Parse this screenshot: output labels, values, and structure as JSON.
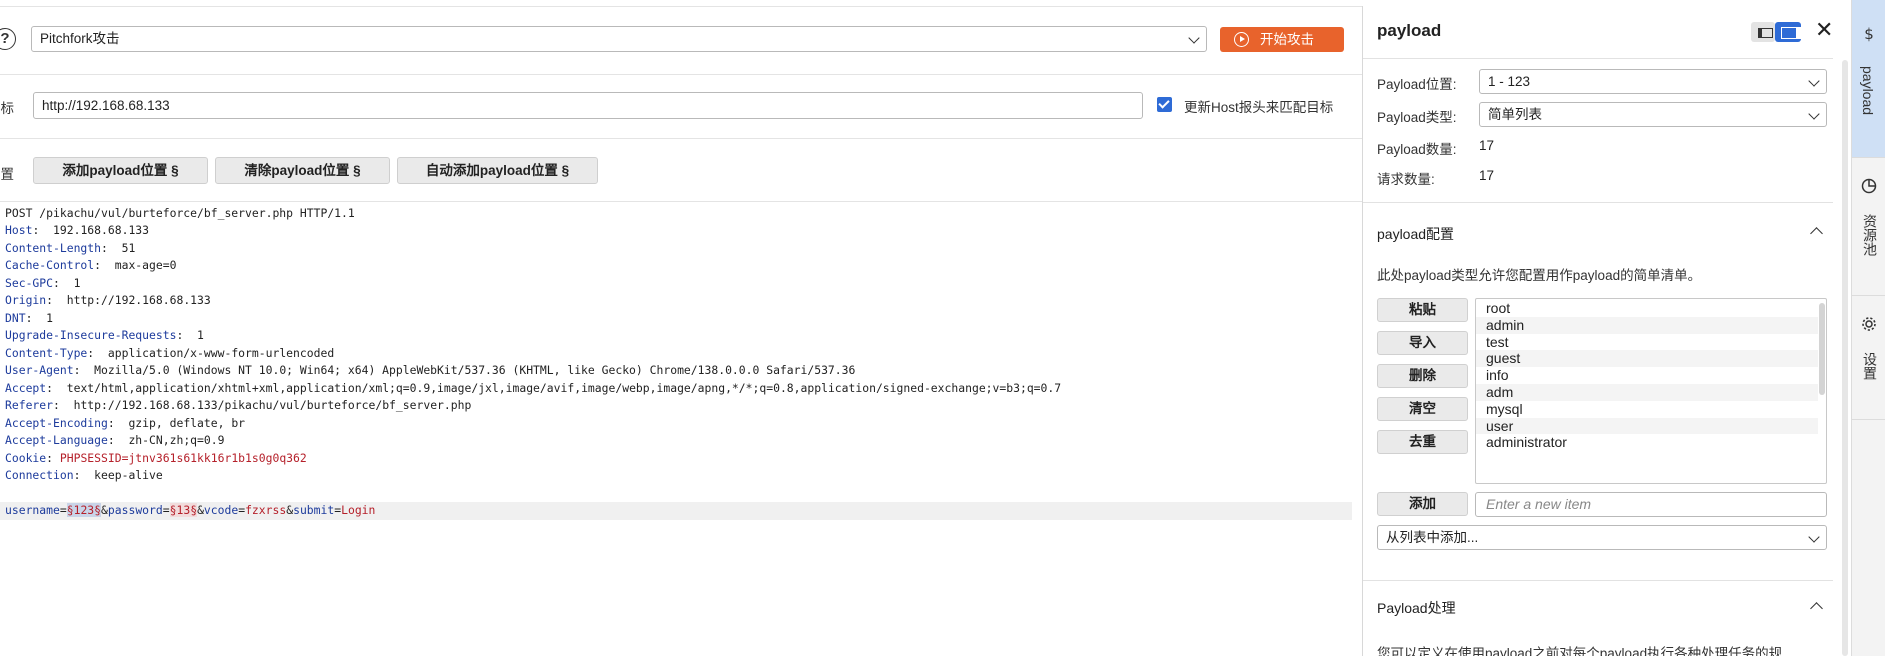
{
  "toolbar": {
    "help_icon": "?",
    "attack_type": "Pitchfork攻击",
    "start_attack": "开始攻击"
  },
  "target": {
    "label": "目标",
    "url": "http://192.168.68.133",
    "update_host_label": "更新Host报头来匹配目标",
    "update_host_checked": true
  },
  "positions": {
    "label": "位置",
    "add_label": "添加payload位置 §",
    "clear_label": "清除payload位置 §",
    "auto_label": "自动添加payload位置 §"
  },
  "request": {
    "request_line": "POST /pikachu/vul/burteforce/bf_server.php HTTP/1.1",
    "headers": [
      {
        "k": "Host",
        "v": " 192.168.68.133"
      },
      {
        "k": "Content-Length",
        "v": " 51"
      },
      {
        "k": "Cache-Control",
        "v": " max-age=0"
      },
      {
        "k": "Sec-GPC",
        "v": " 1"
      },
      {
        "k": "Origin",
        "v": " http://192.168.68.133"
      },
      {
        "k": "DNT",
        "v": " 1"
      },
      {
        "k": "Upgrade-Insecure-Requests",
        "v": " 1"
      },
      {
        "k": "Content-Type",
        "v": " application/x-www-form-urlencoded"
      },
      {
        "k": "User-Agent",
        "v": " Mozilla/5.0 (Windows NT 10.0; Win64; x64) AppleWebKit/537.36 (KHTML, like Gecko) Chrome/138.0.0.0 Safari/537.36"
      },
      {
        "k": "Accept",
        "v": " text/html,application/xhtml+xml,application/xml;q=0.9,image/jxl,image/avif,image/webp,image/apng,*/*;q=0.8,application/signed-exchange;v=b3;q=0.7"
      },
      {
        "k": "Referer",
        "v": " http://192.168.68.133/pikachu/vul/burteforce/bf_server.php"
      },
      {
        "k": "Accept-Encoding",
        "v": " gzip, deflate, br"
      },
      {
        "k": "Accept-Language",
        "v": " zh-CN,zh;q=0.9"
      },
      {
        "k": "Cookie",
        "v": "PHPSESSID=jtnv361s61kk16r1b1s0g0q362"
      },
      {
        "k": "Connection",
        "v": " keep-alive"
      }
    ],
    "body": {
      "p1_key": "username",
      "p1_val": "§123§",
      "p2_key": "password",
      "p2_val": "§13§",
      "p3_key": "vcode",
      "p3_val": "fzxrss",
      "p4_key": "submit",
      "p4_val": "Login"
    }
  },
  "panel": {
    "title": "payload",
    "close": "✕",
    "position_label": "Payload位置:",
    "position_value": "1 - 123",
    "type_label": "Payload类型:",
    "type_value": "简单列表",
    "count_label": "Payload数量:",
    "count_value": "17",
    "requests_label": "请求数量:",
    "requests_value": "17",
    "config_title": "payload配置",
    "config_desc": "此处payload类型允许您配置用作payload的简单清单。",
    "buttons": {
      "paste": "粘贴",
      "import": "导入",
      "delete": "删除",
      "clear": "清空",
      "dedupe": "去重",
      "add": "添加"
    },
    "items": [
      "root",
      "admin",
      "test",
      "guest",
      "info",
      "adm",
      "mysql",
      "user",
      "administrator"
    ],
    "new_item_placeholder": "Enter a new item",
    "add_from_list": "从列表中添加...",
    "processing_title": "Payload处理",
    "processing_desc": "您可以定义在使用payload之前对每个payload执行各种处理任务的规"
  },
  "sidebar": {
    "payload": "payload",
    "resource_pool": "资源池",
    "settings": "设置"
  },
  "colors": {
    "accent": "#e8632c",
    "primary": "#2e6bd6",
    "header_key": "#1d3b9c",
    "param_value": "#b5202a"
  }
}
